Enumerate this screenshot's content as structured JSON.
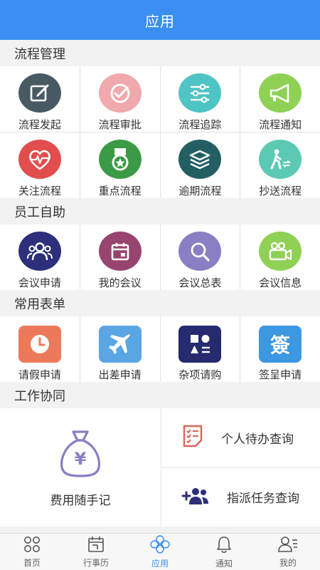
{
  "header": {
    "title": "应用"
  },
  "sections": {
    "process": {
      "title": "流程管理",
      "items": [
        {
          "label": "流程发起",
          "icon": "edit-icon",
          "color": "#4a5a63"
        },
        {
          "label": "流程审批",
          "icon": "approve-check-icon",
          "color": "#f0a9ad"
        },
        {
          "label": "流程追踪",
          "icon": "sliders-icon",
          "color": "#4ec5c4"
        },
        {
          "label": "流程通知",
          "icon": "megaphone-icon",
          "color": "#8fd155"
        },
        {
          "label": "关注流程",
          "icon": "heart-pulse-icon",
          "color": "#e24d4d"
        },
        {
          "label": "重点流程",
          "icon": "medal-icon",
          "color": "#3a9a45"
        },
        {
          "label": "逾期流程",
          "icon": "layers-icon",
          "color": "#235f62"
        },
        {
          "label": "抄送流程",
          "icon": "walker-icon",
          "color": "#5cc9b3"
        }
      ]
    },
    "self_service": {
      "title": "员工自助",
      "items": [
        {
          "label": "会议申请",
          "icon": "people-icon",
          "color": "#2d2f7a"
        },
        {
          "label": "我的会议",
          "icon": "calendar-icon",
          "color": "#97456f"
        },
        {
          "label": "会议总表",
          "icon": "magnifier-icon",
          "color": "#8a7fc4"
        },
        {
          "label": "会议信息",
          "icon": "video-camera-icon",
          "color": "#8fd155"
        }
      ]
    },
    "forms": {
      "title": "常用表单",
      "items": [
        {
          "label": "请假申请",
          "icon": "clock-icon",
          "color": "#ec7a5a"
        },
        {
          "label": "出差申请",
          "icon": "airplane-icon",
          "color": "#5aa6e5"
        },
        {
          "label": "杂项请购",
          "icon": "shapes-icon",
          "color": "#252b6e"
        },
        {
          "label": "签呈申请",
          "icon": "sign-character-icon",
          "glyph": "簽",
          "color": "#3d98e2"
        }
      ]
    },
    "collab": {
      "title": "工作协同",
      "expense": {
        "label": "费用随手记",
        "symbol": "¥"
      },
      "todo": {
        "label": "个人待办查询"
      },
      "assign": {
        "label": "指派任务查询"
      }
    }
  },
  "tabs": [
    {
      "label": "首页",
      "icon": "home-grid-icon"
    },
    {
      "label": "行事历",
      "icon": "calendar-tab-icon"
    },
    {
      "label": "应用",
      "icon": "apps-flower-icon",
      "active": true
    },
    {
      "label": "通知",
      "icon": "bell-icon"
    },
    {
      "label": "我的",
      "icon": "profile-icon"
    }
  ],
  "colors": {
    "accent": "#3b8ff2",
    "icon_purple": "#8a7fc4",
    "icon_coral": "#d9655a",
    "icon_navy": "#2d2f7a"
  }
}
